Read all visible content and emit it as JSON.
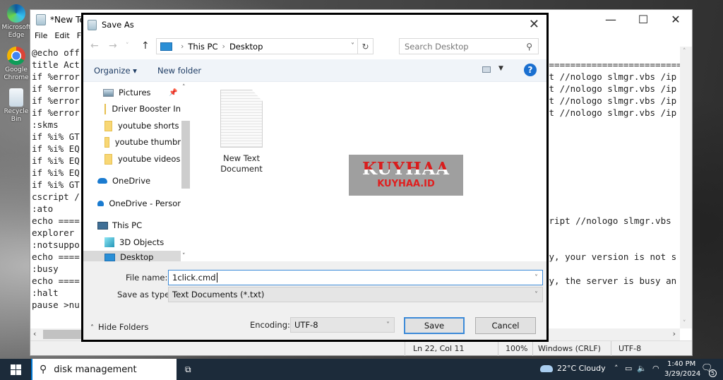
{
  "desktop": {
    "icons": [
      {
        "label": "Microsoft Edge",
        "icon": "edge-icon"
      },
      {
        "label": "Google Chrome",
        "icon": "chrome-icon"
      },
      {
        "label": "Recycle Bin",
        "icon": "recycle-bin-icon"
      }
    ]
  },
  "notepad": {
    "title": "*New Text Document - Notepad",
    "title_visible": "*New Tex",
    "menu": [
      "File",
      "Edit",
      "Format"
    ],
    "menu_visible": [
      "File",
      "Edit",
      "F"
    ],
    "window_controls": {
      "minimize": "—",
      "maximize": "☐",
      "close": "✕"
    },
    "lines_left": [
      "@echo off",
      "title Act",
      "if %error",
      "if %error",
      "if %error",
      "if %error",
      ":skms",
      "if %i% GT",
      "if %i% EQ",
      "if %i% EQ",
      "if %i% EQ",
      "if %i% GT",
      "cscript /",
      ":ato",
      "echo ====",
      "explorer",
      ":notsuppo",
      "echo ====",
      ":busy",
      "echo ====",
      ":halt",
      "pause >nu"
    ],
    "lines_right": [
      "",
      "===============================",
      "pt //nologo slmgr.vbs /ip",
      "pt //nologo slmgr.vbs /ip",
      "pt //nologo slmgr.vbs /ip",
      "pt //nologo slmgr.vbs /ip",
      "",
      "",
      "",
      "",
      "",
      "",
      "",
      "",
      "cript //nologo slmgr.vbs",
      "",
      "",
      "ry, your version is not s",
      "",
      "ry, the server is busy an"
    ],
    "status": {
      "position": "Ln 22, Col 11",
      "zoom": "100%",
      "line_ending": "Windows (CRLF)",
      "encoding": "UTF-8"
    }
  },
  "dialog": {
    "title": "Save As",
    "close": "✕",
    "breadcrumb": [
      "This PC",
      "Desktop"
    ],
    "search_placeholder": "Search Desktop",
    "toolbar": {
      "organize": "Organize ▾",
      "new_folder": "New folder",
      "help": "?"
    },
    "nav_items": [
      {
        "label": "Pictures",
        "icon": "pictures-icon",
        "pinned": true
      },
      {
        "label": "Driver Booster In",
        "icon": "folder-icon"
      },
      {
        "label": "youtube shorts",
        "icon": "folder-icon"
      },
      {
        "label": "youtube thumbr",
        "icon": "folder-icon"
      },
      {
        "label": "youtube videos",
        "icon": "folder-icon"
      },
      {
        "label": "OneDrive",
        "icon": "onedrive-icon"
      },
      {
        "label": "OneDrive - Persor",
        "icon": "onedrive-icon"
      },
      {
        "label": "This PC",
        "icon": "this-pc-icon"
      },
      {
        "label": "3D Objects",
        "icon": "3d-objects-icon"
      },
      {
        "label": "Desktop",
        "icon": "desktop-icon",
        "selected": true
      }
    ],
    "files": [
      {
        "line1": "New Text",
        "line2": "Document"
      }
    ],
    "watermark": {
      "big": "KUYHAA",
      "small": "KUYHAA.ID"
    },
    "file_name_label": "File name:",
    "file_name_value": "1click.cmd",
    "save_type_label": "Save as type:",
    "save_type_value": "Text Documents (*.txt)",
    "hide_folders": "Hide Folders",
    "encoding_label": "Encoding:",
    "encoding_value": "UTF-8",
    "save_button": "Save",
    "cancel_button": "Cancel"
  },
  "taskbar": {
    "search_value": "disk management",
    "weather": "22°C  Cloudy",
    "time": "1:40 PM",
    "date": "3/29/2024",
    "notifications": "5"
  }
}
